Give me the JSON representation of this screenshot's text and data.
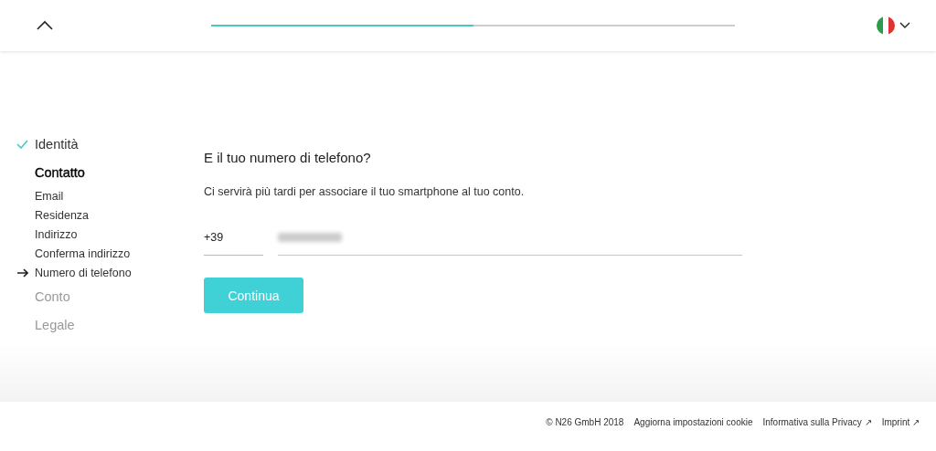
{
  "header": {
    "progress": {
      "level": 0.5
    }
  },
  "steps": [
    {
      "label": "Identità",
      "completed": true,
      "current": false
    },
    {
      "label": "Contatto",
      "completed": false,
      "current": true,
      "substeps": [
        {
          "label": "Email",
          "selected": false
        },
        {
          "label": "Residenza",
          "selected": false
        },
        {
          "label": "Indirizzo",
          "selected": false
        },
        {
          "label": "Conferma indirizzo",
          "selected": false
        },
        {
          "label": "Numero di telefono",
          "selected": true
        }
      ]
    },
    {
      "label": "Conto",
      "completed": false,
      "current": false
    },
    {
      "label": "Legale",
      "completed": false,
      "current": false
    }
  ],
  "form": {
    "title": "E il tuo numero di telefono?",
    "description": "Ci servirà più tardi per associare il tuo smartphone al tuo conto.",
    "prefix": "+39",
    "button": "Continua"
  },
  "footer": {
    "links": [
      "© N26 GmbH 2018",
      "Aggiorna impostazioni cookie",
      "Informativa sulla Privacy ↗",
      "Imprint ↗"
    ]
  }
}
